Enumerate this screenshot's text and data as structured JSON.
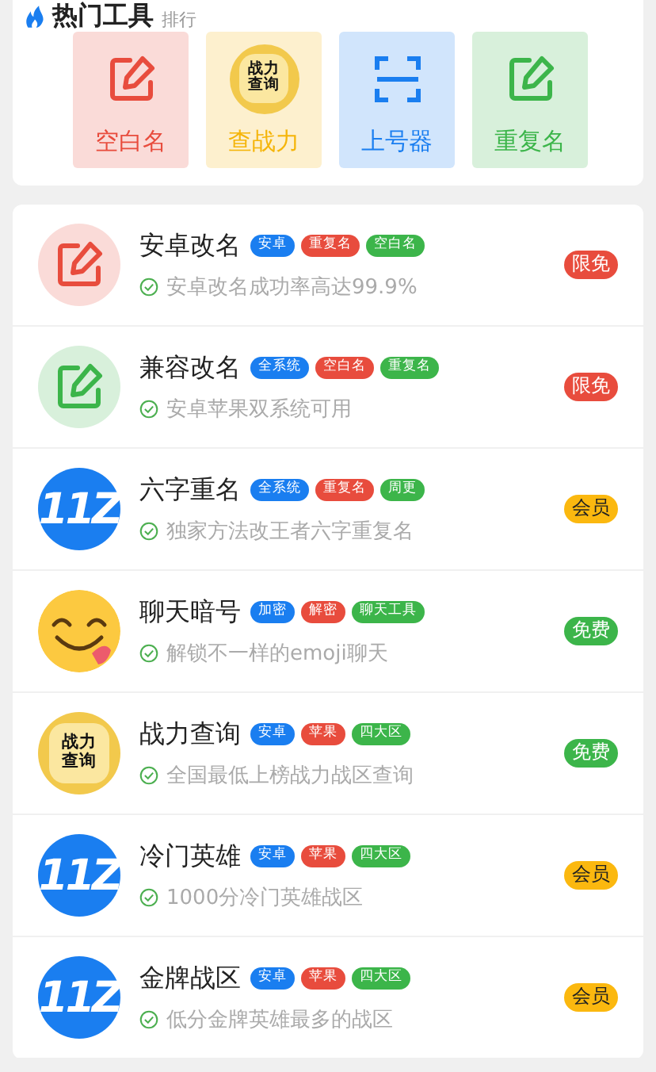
{
  "hot_tools": {
    "title": "热门工具",
    "subtitle": "排行",
    "tiles": [
      {
        "label": "空白名",
        "color": "#e84c3d",
        "icon": {
          "kind": "edit"
        }
      },
      {
        "label": "查战力",
        "color": "#f5b50a",
        "icon": {
          "kind": "badge",
          "text": "战力查询"
        }
      },
      {
        "label": "上号器",
        "color": "#1a7ef0",
        "icon": {
          "kind": "scan"
        }
      },
      {
        "label": "重复名",
        "color": "#3cb54a",
        "icon": {
          "kind": "edit"
        }
      }
    ]
  },
  "tools": [
    {
      "name": "安卓改名",
      "avatar": {
        "kind": "edit",
        "color": "#e84c3d"
      },
      "tags": [
        {
          "text": "安卓",
          "color": "#1a7ef0"
        },
        {
          "text": "重复名",
          "color": "#e84c3d"
        },
        {
          "text": "空白名",
          "color": "#3cb54a"
        }
      ],
      "desc": "安卓改名成功率高达99.9%",
      "badge": {
        "text": "限免",
        "kind": "limited"
      }
    },
    {
      "name": "兼容改名",
      "avatar": {
        "kind": "edit",
        "color": "#3cb54a"
      },
      "tags": [
        {
          "text": "全系统",
          "color": "#1a7ef0"
        },
        {
          "text": "空白名",
          "color": "#e84c3d"
        },
        {
          "text": "重复名",
          "color": "#3cb54a"
        }
      ],
      "desc": "安卓苹果双系统可用",
      "badge": {
        "text": "限免",
        "kind": "limited"
      }
    },
    {
      "name": "六字重名",
      "avatar": {
        "kind": "logo",
        "text": "11Z"
      },
      "tags": [
        {
          "text": "全系统",
          "color": "#1a7ef0"
        },
        {
          "text": "重复名",
          "color": "#e84c3d"
        },
        {
          "text": "周更",
          "color": "#3cb54a"
        }
      ],
      "desc": "独家方法改王者六字重复名",
      "badge": {
        "text": "会员",
        "kind": "member"
      }
    },
    {
      "name": "聊天暗号",
      "avatar": {
        "kind": "emoji"
      },
      "tags": [
        {
          "text": "加密",
          "color": "#1a7ef0"
        },
        {
          "text": "解密",
          "color": "#e84c3d"
        },
        {
          "text": "聊天工具",
          "color": "#3cb54a"
        }
      ],
      "desc": "解锁不一样的emoji聊天",
      "badge": {
        "text": "免费",
        "kind": "free"
      }
    },
    {
      "name": "战力查询",
      "avatar": {
        "kind": "badge",
        "text": "战力查询"
      },
      "tags": [
        {
          "text": "安卓",
          "color": "#1a7ef0"
        },
        {
          "text": "苹果",
          "color": "#e84c3d"
        },
        {
          "text": "四大区",
          "color": "#3cb54a"
        }
      ],
      "desc": "全国最低上榜战力战区查询",
      "badge": {
        "text": "免费",
        "kind": "free"
      }
    },
    {
      "name": "冷门英雄",
      "avatar": {
        "kind": "logo",
        "text": "11Z"
      },
      "tags": [
        {
          "text": "安卓",
          "color": "#1a7ef0"
        },
        {
          "text": "苹果",
          "color": "#e84c3d"
        },
        {
          "text": "四大区",
          "color": "#3cb54a"
        }
      ],
      "desc": "1000分冷门英雄战区",
      "badge": {
        "text": "会员",
        "kind": "member"
      }
    },
    {
      "name": "金牌战区",
      "avatar": {
        "kind": "logo",
        "text": "11Z"
      },
      "tags": [
        {
          "text": "安卓",
          "color": "#1a7ef0"
        },
        {
          "text": "苹果",
          "color": "#e84c3d"
        },
        {
          "text": "四大区",
          "color": "#3cb54a"
        }
      ],
      "desc": "低分金牌英雄最多的战区",
      "badge": {
        "text": "会员",
        "kind": "member"
      }
    }
  ]
}
